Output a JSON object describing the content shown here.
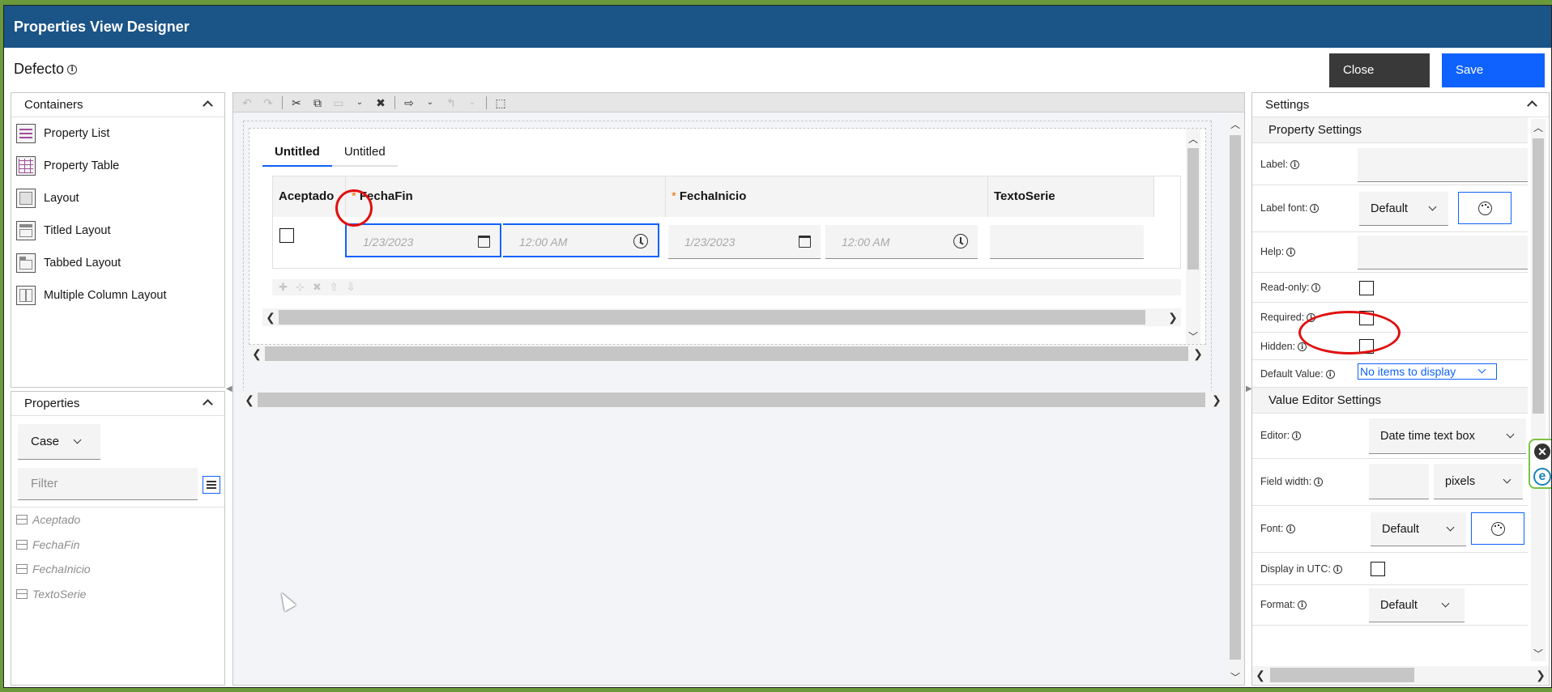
{
  "app": {
    "title": "Properties View Designer"
  },
  "header": {
    "doc_title": "Defecto",
    "close_label": "Close",
    "save_label": "Save"
  },
  "containers": {
    "title": "Containers",
    "items": [
      {
        "label": "Property List",
        "icon": "property-list-icon"
      },
      {
        "label": "Property Table",
        "icon": "property-table-icon"
      },
      {
        "label": "Layout",
        "icon": "layout-icon"
      },
      {
        "label": "Titled Layout",
        "icon": "titled-layout-icon"
      },
      {
        "label": "Tabbed Layout",
        "icon": "tabbed-layout-icon"
      },
      {
        "label": "Multiple Column Layout",
        "icon": "multiple-column-layout-icon"
      }
    ]
  },
  "properties": {
    "title": "Properties",
    "class_select": "Case",
    "filter_placeholder": "Filter",
    "items": [
      "Aceptado",
      "FechaFin",
      "FechaInicio",
      "TextoSerie"
    ]
  },
  "canvas": {
    "tabs": [
      "Untitled",
      "Untitled"
    ],
    "columns": [
      {
        "label": "Aceptado",
        "required": false
      },
      {
        "label": "FechaFin",
        "required": true
      },
      {
        "label": "FechaInicio",
        "required": true
      },
      {
        "label": "TextoSerie",
        "required": false
      }
    ],
    "required_marker": "*",
    "date_placeholder": "1/23/2023",
    "time_placeholder": "12:00 AM"
  },
  "settings": {
    "title": "Settings",
    "property_section": "Property Settings",
    "labels": {
      "label": "Label:",
      "label_font": "Label font:",
      "help": "Help:",
      "read_only": "Read-only:",
      "required": "Required:",
      "hidden": "Hidden:",
      "default_value": "Default Value:"
    },
    "label_font_value": "Default",
    "default_value": "No items to display",
    "value_editor_section": "Value Editor Settings",
    "editor_labels": {
      "editor": "Editor:",
      "field_width": "Field width:",
      "font": "Font:",
      "display_utc": "Display in UTC:",
      "format": "Format:"
    },
    "editor_value": "Date time text box",
    "width_unit": "pixels",
    "font_value": "Default",
    "format_value": "Default"
  },
  "colors": {
    "header": "#1b5486",
    "primary": "#0f62fe",
    "annotation": "#e01010"
  }
}
